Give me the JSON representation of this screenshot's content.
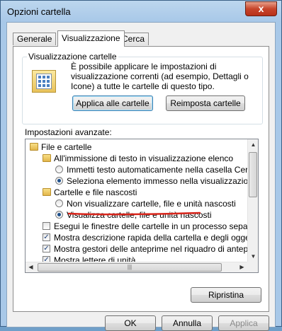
{
  "window": {
    "title": "Opzioni cartella",
    "close_label": "x"
  },
  "tabs": [
    {
      "label": "Generale"
    },
    {
      "label": "Visualizzazione"
    },
    {
      "label": "Cerca"
    }
  ],
  "folder_view": {
    "legend": "Visualizzazione cartelle",
    "description": "È possibile applicare le impostazioni di visualizzazione correnti (ad esempio, Dettagli o Icone) a tutte le cartelle di questo tipo.",
    "apply_label": "Applica alle cartelle",
    "reset_label": "Reimposta cartelle"
  },
  "advanced": {
    "label": "Impostazioni avanzate:",
    "items": [
      {
        "type": "folder",
        "text": "File e cartelle"
      },
      {
        "type": "folder",
        "text": "All'immissione di testo in visualizzazione elenco"
      },
      {
        "type": "radio",
        "checked": false,
        "text": "Immetti testo automaticamente nella casella Cerca"
      },
      {
        "type": "radio",
        "checked": true,
        "text": "Seleziona elemento immesso nella visualizzazione"
      },
      {
        "type": "folder",
        "text": "Cartelle e file nascosti"
      },
      {
        "type": "radio",
        "checked": false,
        "text": "Non visualizzare cartelle, file e unità nascosti"
      },
      {
        "type": "radio",
        "checked": true,
        "text": "Visualizza cartelle, file e unità nascosti"
      },
      {
        "type": "checkbox",
        "checked": false,
        "text": "Esegui le finestre delle cartelle in un processo separato"
      },
      {
        "type": "checkbox",
        "checked": true,
        "text": "Mostra descrizione rapida della cartella e degli oggetti del"
      },
      {
        "type": "checkbox",
        "checked": true,
        "text": "Mostra gestori delle anteprime nel riquadro di anteprima"
      },
      {
        "type": "checkbox",
        "checked": true,
        "text": "Mostra lettere di unità"
      }
    ],
    "restore_label": "Ripristina"
  },
  "footer": {
    "ok_label": "OK",
    "cancel_label": "Annulla",
    "apply_label": "Applica"
  },
  "colors": {
    "annotation_underline": "#d9261c"
  }
}
